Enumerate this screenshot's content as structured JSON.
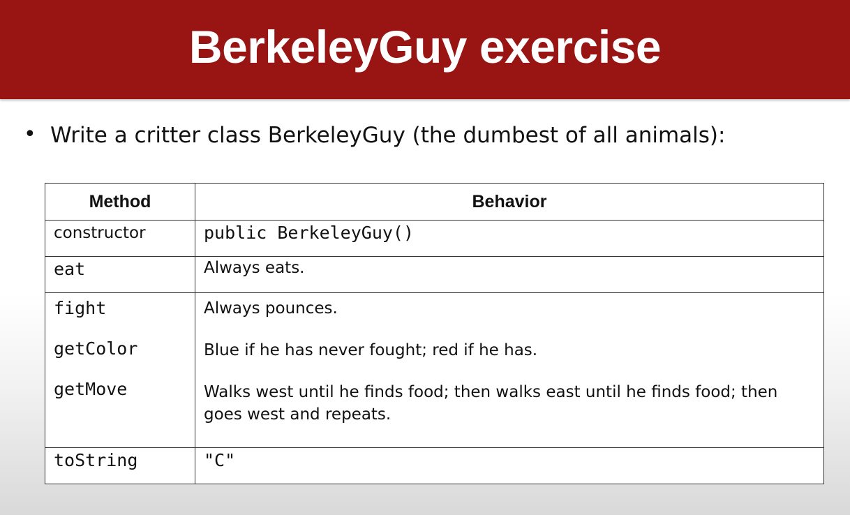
{
  "slide": {
    "title": "BerkeleyGuy exercise",
    "bullet_symbol": "•",
    "bullet_text": "Write a critter class BerkeleyGuy (the dumbest of all animals):"
  },
  "table": {
    "headers": {
      "method": "Method",
      "behavior": "Behavior"
    },
    "rows": [
      {
        "method": "constructor",
        "behavior": "public BerkeleyGuy()"
      },
      {
        "method": "eat",
        "behavior": "Always eats."
      },
      {
        "method": "fight",
        "behavior": "Always pounces."
      },
      {
        "method": "getColor",
        "behavior": "Blue if he has never fought; red if he has."
      },
      {
        "method": "getMove",
        "behavior": "Walks west until he finds food; then walks east until he finds food; then goes west and repeats."
      },
      {
        "method": "toString",
        "behavior": "\"C\""
      }
    ]
  },
  "colors": {
    "title_bar": "#981514",
    "title_text": "#ffffff",
    "border": "#333333"
  }
}
